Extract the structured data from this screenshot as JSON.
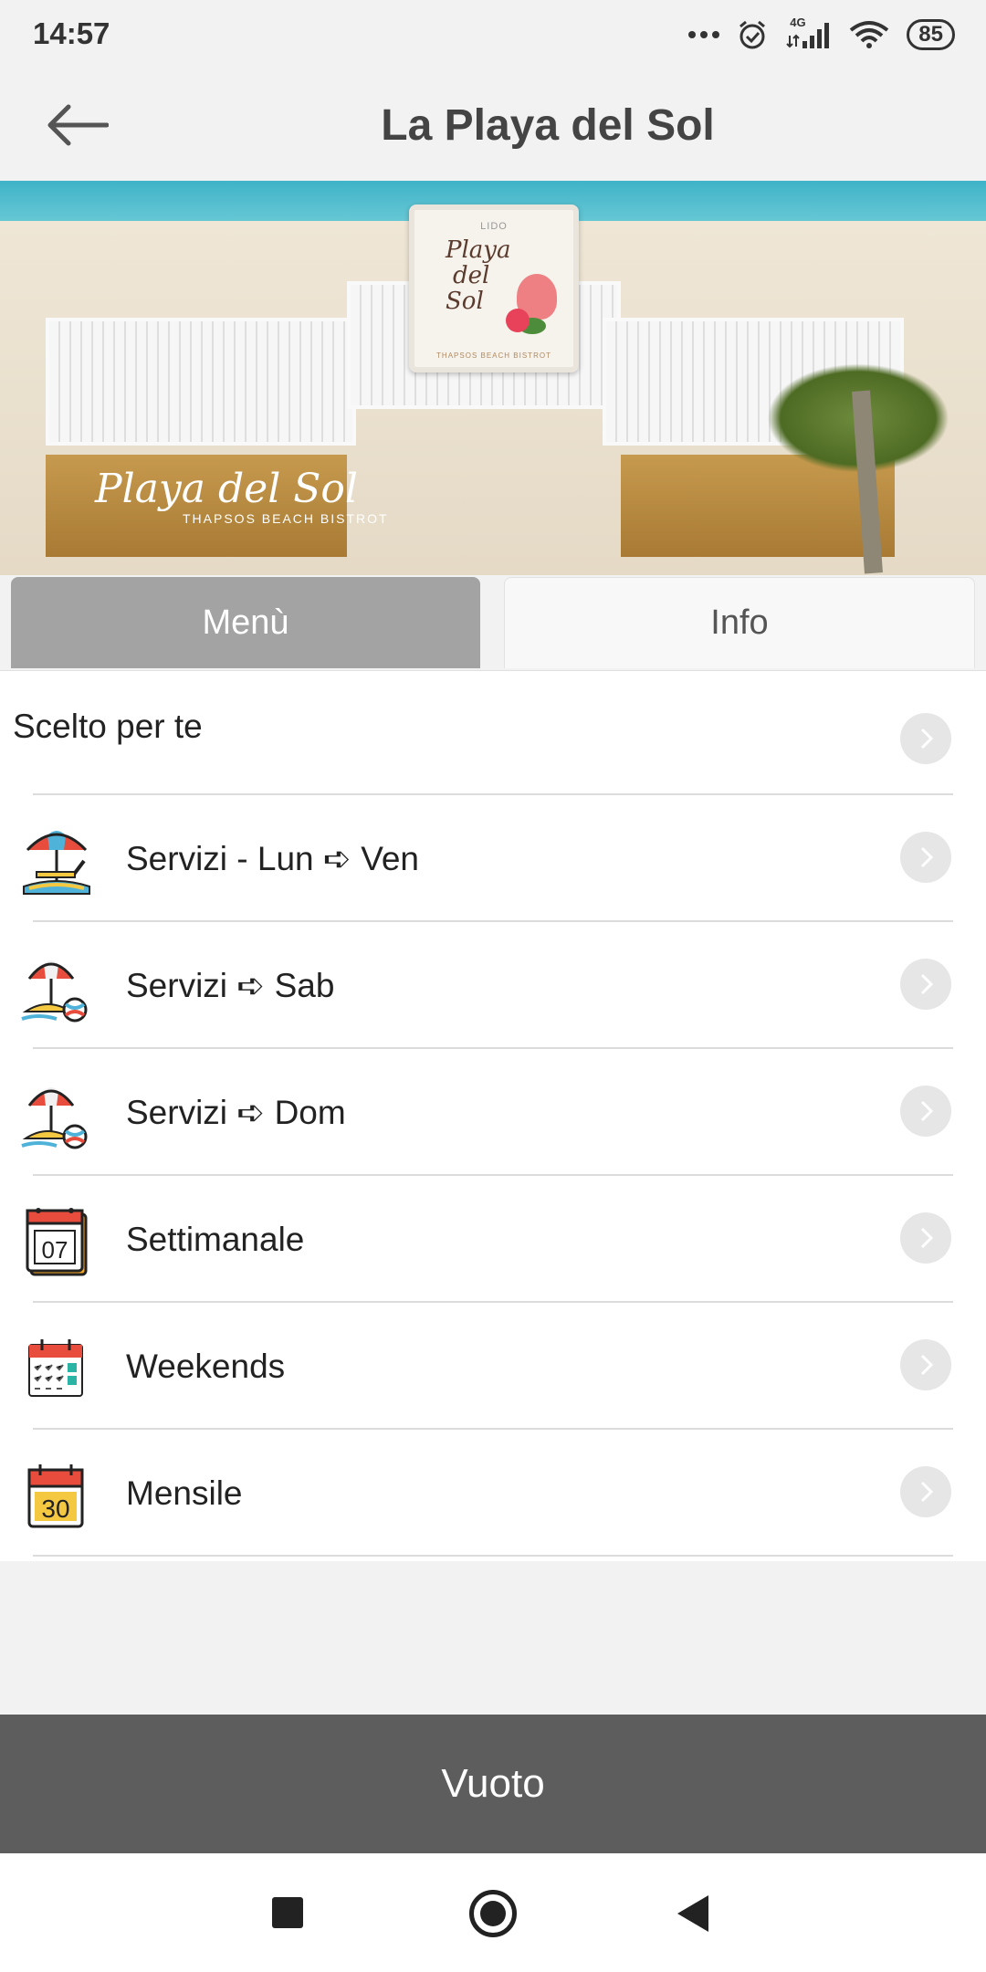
{
  "status_bar": {
    "time": "14:57",
    "network": "4G",
    "battery": "85"
  },
  "header": {
    "title": "La Playa del Sol",
    "back_icon": "arrow-left-icon"
  },
  "hero": {
    "logo_lido": "LIDO",
    "logo_line1": "Playa",
    "logo_line2": "del",
    "logo_line3": "Sol",
    "logo_sub": "THAPSOS BEACH BISTROT",
    "wall_text": "Playa del Sol",
    "wall_sub": "THAPSOS BEACH BISTROT"
  },
  "tabs": [
    {
      "label": "Menù",
      "active": true
    },
    {
      "label": "Info",
      "active": false
    }
  ],
  "list": {
    "items": [
      {
        "label": "Scelto per te",
        "icon": ""
      },
      {
        "label": "Servizi - Lun ➪ Ven",
        "icon": "beach-umbrella-lounger-icon"
      },
      {
        "label": "Servizi ➪ Sab",
        "icon": "beach-umbrella-ball-icon"
      },
      {
        "label": "Servizi ➪ Dom",
        "icon": "beach-umbrella-ball-icon"
      },
      {
        "label": "Settimanale",
        "icon": "calendar-07-icon",
        "icon_text": "07"
      },
      {
        "label": "Weekends",
        "icon": "calendar-grid-icon"
      },
      {
        "label": "Mensile",
        "icon": "calendar-30-icon",
        "icon_text": "30"
      }
    ]
  },
  "footer": {
    "button_label": "Vuoto"
  },
  "colors": {
    "tab_active": "#a3a3a3",
    "bottom_button": "#5d5d5d",
    "background": "#f2f2f2"
  }
}
